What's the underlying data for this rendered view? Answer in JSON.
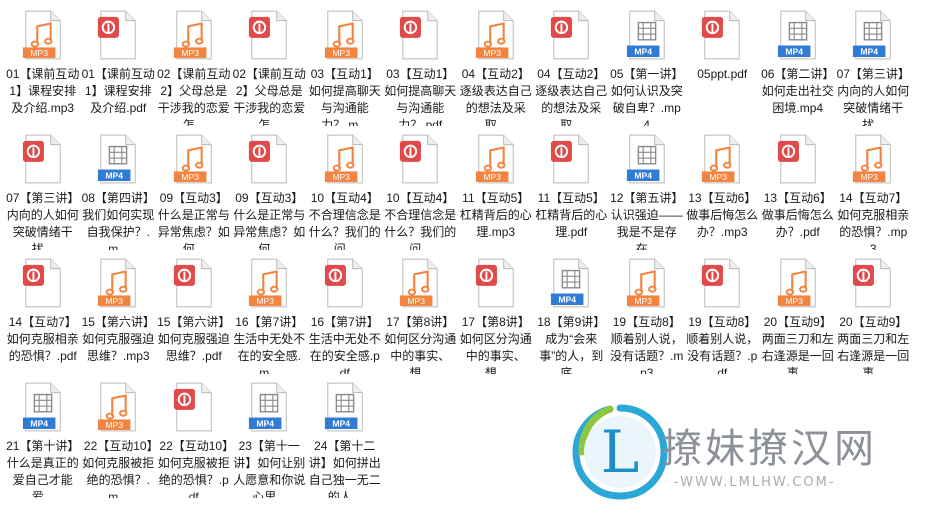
{
  "colors": {
    "mp3": "#f2843f",
    "pdf": "#e04a4a",
    "mp4": "#2f7bd6",
    "page": "#ffffff",
    "text": "#1a1a1a"
  },
  "files": [
    {
      "name": "01【课前互动1】课程安排及介绍.mp3",
      "type": "mp3",
      "badge": "MP3",
      "icon": "audio-file-icon"
    },
    {
      "name": "01【课前互动1】课程安排及介绍.pdf",
      "type": "pdf",
      "badge": "",
      "icon": "pdf-file-icon"
    },
    {
      "name": "02【课前互动2】父母总是干涉我的恋爱怎...",
      "type": "mp3",
      "badge": "MP3",
      "icon": "audio-file-icon"
    },
    {
      "name": "02【课前互动2】父母总是干涉我的恋爱怎...",
      "type": "pdf",
      "badge": "",
      "icon": "pdf-file-icon"
    },
    {
      "name": "03【互动1】如何提高聊天与沟通能力？.m...",
      "type": "mp3",
      "badge": "MP3",
      "icon": "audio-file-icon"
    },
    {
      "name": "03【互动1】如何提高聊天与沟通能力？.pdf",
      "type": "pdf",
      "badge": "",
      "icon": "pdf-file-icon"
    },
    {
      "name": "04【互动2】逐级表达自己的想法及采取...",
      "type": "mp3",
      "badge": "MP3",
      "icon": "audio-file-icon"
    },
    {
      "name": "04【互动2】逐级表达自己的想法及采取...",
      "type": "pdf",
      "badge": "",
      "icon": "pdf-file-icon"
    },
    {
      "name": "05【第一讲】如何认识及突破自卑？.mp4",
      "type": "mp4",
      "badge": "MP4",
      "icon": "video-file-icon"
    },
    {
      "name": "05ppt.pdf",
      "type": "pdf",
      "badge": "",
      "icon": "pdf-file-icon"
    },
    {
      "name": "06【第二讲】如何走出社交困境.mp4",
      "type": "mp4",
      "badge": "MP4",
      "icon": "video-file-icon"
    },
    {
      "name": "07【第三讲】内向的人如何突破情绪干扰...",
      "type": "mp4",
      "badge": "MP4",
      "icon": "video-file-icon"
    },
    {
      "name": "07【第三讲】内向的人如何突破情绪干扰...",
      "type": "pdf",
      "badge": "",
      "icon": "pdf-file-icon"
    },
    {
      "name": "08【第四讲】我们如何实现自我保护？.m...",
      "type": "mp4",
      "badge": "MP4",
      "icon": "video-file-icon"
    },
    {
      "name": "09【互动3】什么是正常与异常焦虑？如何...",
      "type": "mp3",
      "badge": "MP3",
      "icon": "audio-file-icon"
    },
    {
      "name": "09【互动3】什么是正常与异常焦虑？如何...",
      "type": "pdf",
      "badge": "",
      "icon": "pdf-file-icon"
    },
    {
      "name": "10【互动4】不合理信念是什么？我们的问...",
      "type": "mp3",
      "badge": "MP3",
      "icon": "audio-file-icon"
    },
    {
      "name": "10【互动4】不合理信念是什么？我们的问...",
      "type": "pdf",
      "badge": "",
      "icon": "pdf-file-icon"
    },
    {
      "name": "11【互动5】杠精背后的心理.mp3",
      "type": "mp3",
      "badge": "MP3",
      "icon": "audio-file-icon"
    },
    {
      "name": "11【互动5】杠精背后的心理.pdf",
      "type": "pdf",
      "badge": "",
      "icon": "pdf-file-icon"
    },
    {
      "name": "12【第五讲】认识强迫——我是不是存在...",
      "type": "mp4",
      "badge": "MP4",
      "icon": "video-file-icon"
    },
    {
      "name": "13【互动6】做事后悔怎么办？.mp3",
      "type": "mp3",
      "badge": "MP3",
      "icon": "audio-file-icon"
    },
    {
      "name": "13【互动6】做事后悔怎么办？.pdf",
      "type": "pdf",
      "badge": "",
      "icon": "pdf-file-icon"
    },
    {
      "name": "14【互动7】如何克服相亲的恐惧？.mp3",
      "type": "mp3",
      "badge": "MP3",
      "icon": "audio-file-icon"
    },
    {
      "name": "14【互动7】如何克服相亲的恐惧？.pdf",
      "type": "pdf",
      "badge": "",
      "icon": "pdf-file-icon"
    },
    {
      "name": "15【第六讲】如何克服强迫思维？.mp3",
      "type": "mp3",
      "badge": "MP3",
      "icon": "audio-file-icon"
    },
    {
      "name": "15【第六讲】如何克服强迫思维？.pdf",
      "type": "pdf",
      "badge": "",
      "icon": "pdf-file-icon"
    },
    {
      "name": "16【第7讲】生活中无处不在的安全感.m...",
      "type": "mp3",
      "badge": "MP3",
      "icon": "audio-file-icon"
    },
    {
      "name": "16【第7讲】生活中无处不在的安全感.pdf",
      "type": "pdf",
      "badge": "",
      "icon": "pdf-file-icon"
    },
    {
      "name": "17【第8讲】如何区分沟通中的事实、想...",
      "type": "mp3",
      "badge": "MP3",
      "icon": "audio-file-icon"
    },
    {
      "name": "17【第8讲】如何区分沟通中的事实、想...",
      "type": "pdf",
      "badge": "",
      "icon": "pdf-file-icon"
    },
    {
      "name": "18【第9讲】成为“会来事”的人，到底...",
      "type": "mp4",
      "badge": "MP4",
      "icon": "video-file-icon"
    },
    {
      "name": "19【互动8】顺着别人说，没有话题？.mp3",
      "type": "mp3",
      "badge": "MP3",
      "icon": "audio-file-icon"
    },
    {
      "name": "19【互动8】顺着别人说，没有话题？.pdf",
      "type": "pdf",
      "badge": "",
      "icon": "pdf-file-icon"
    },
    {
      "name": "20【互动9】两面三刀和左右逢源是一回事...",
      "type": "mp3",
      "badge": "MP3",
      "icon": "audio-file-icon"
    },
    {
      "name": "20【互动9】两面三刀和左右逢源是一回事...",
      "type": "pdf",
      "badge": "",
      "icon": "pdf-file-icon"
    },
    {
      "name": "21【第十讲】什么是真正的爱自己才能爱...",
      "type": "mp4",
      "badge": "MP4",
      "icon": "video-file-icon"
    },
    {
      "name": "22【互动10】如何克服被拒绝的恐惧？.m...",
      "type": "mp3",
      "badge": "MP3",
      "icon": "audio-file-icon"
    },
    {
      "name": "22【互动10】如何克服被拒绝的恐惧？.pdf",
      "type": "pdf",
      "badge": "",
      "icon": "pdf-file-icon"
    },
    {
      "name": "23【第十一讲】如何让别人愿意和你说心里...",
      "type": "mp4",
      "badge": "MP4",
      "icon": "video-file-icon"
    },
    {
      "name": "24【第十二讲】如何拼出自己独一无二的人...",
      "type": "mp4",
      "badge": "MP4",
      "icon": "video-file-icon"
    }
  ],
  "watermark": {
    "logo_letter": "L",
    "text": "撩妹撩汉网",
    "url": "-WWW.LMLHW.COM-",
    "logo_icon": "site-logo-icon"
  }
}
